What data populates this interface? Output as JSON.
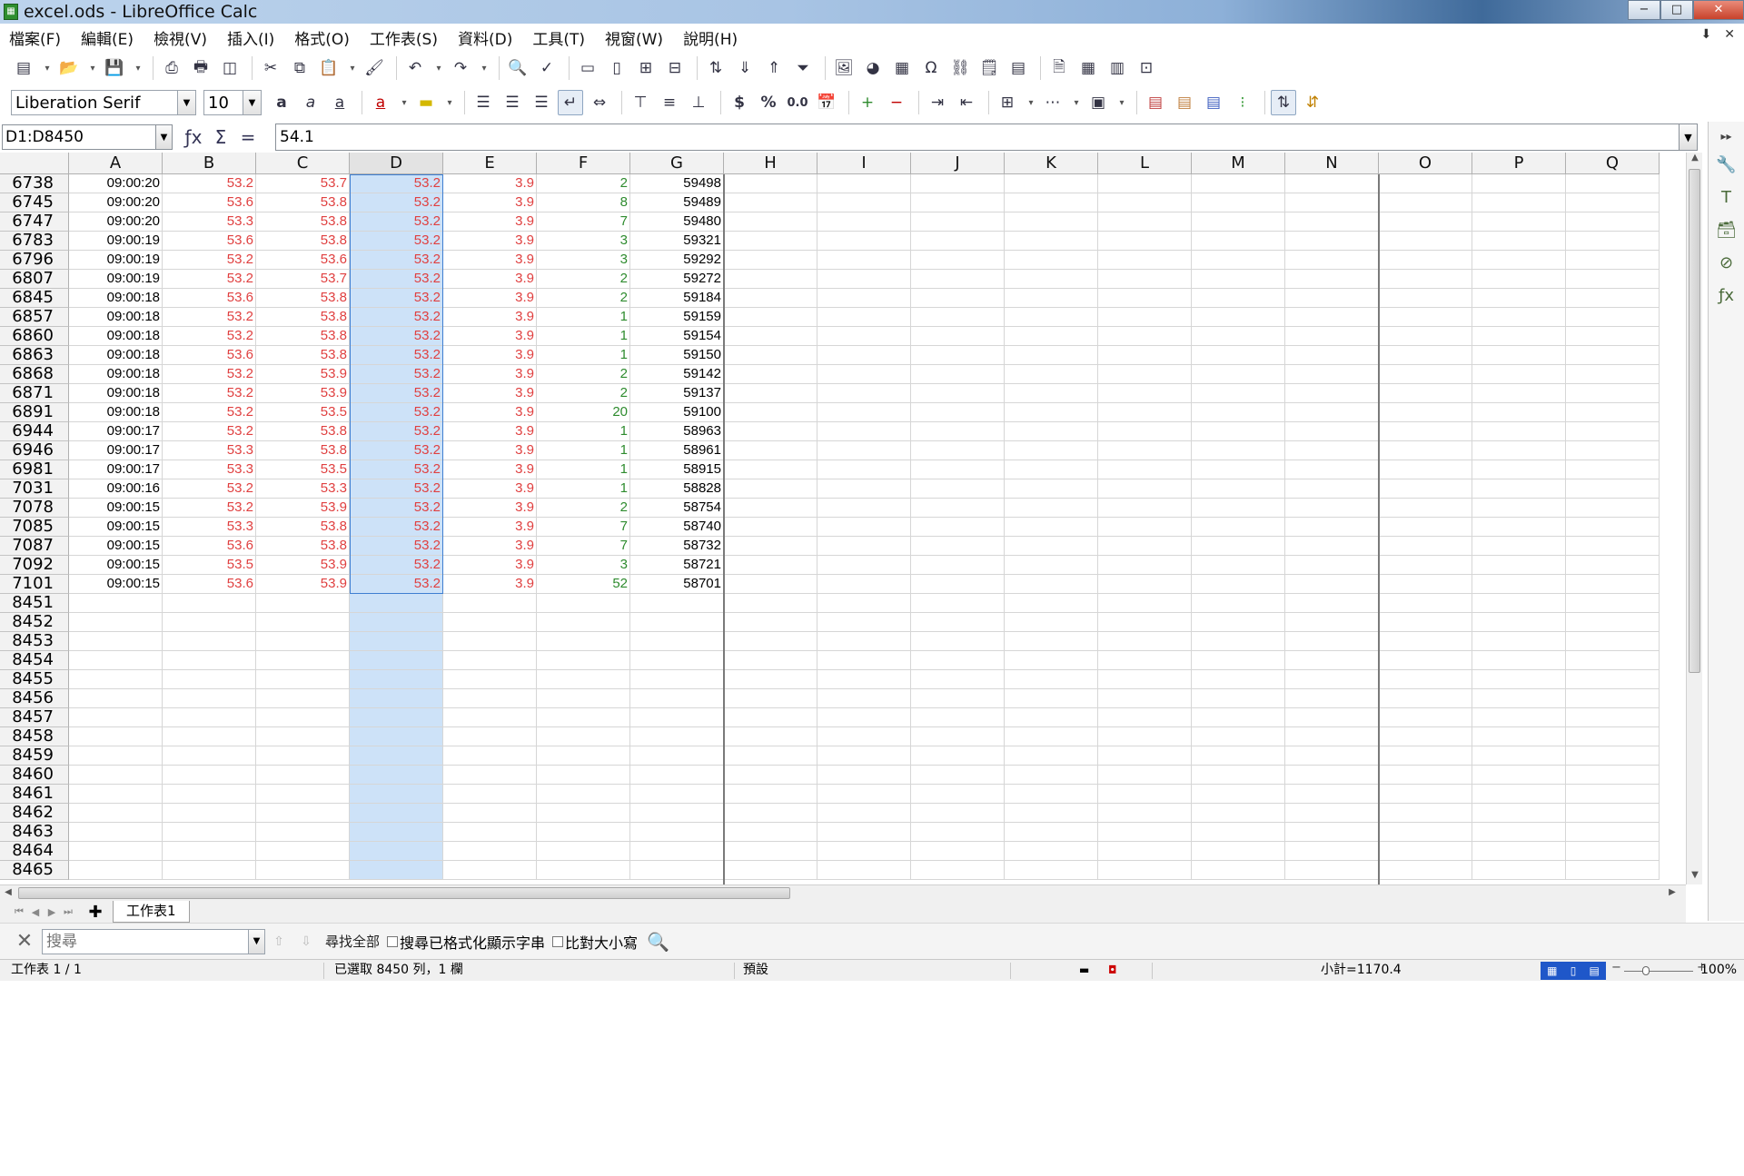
{
  "window": {
    "title": "excel.ods - LibreOffice Calc",
    "minimize": "−",
    "maximize": "□",
    "close": "✕"
  },
  "menu": [
    "檔案(F)",
    "編輯(E)",
    "檢視(V)",
    "插入(I)",
    "格式(O)",
    "工作表(S)",
    "資料(D)",
    "工具(T)",
    "視窗(W)",
    "說明(H)"
  ],
  "font": {
    "name": "Liberation Serif",
    "size": "10"
  },
  "formula": {
    "name_box": "D1:D8450",
    "content": "54.1"
  },
  "columns": [
    "A",
    "B",
    "C",
    "D",
    "E",
    "F",
    "G",
    "H",
    "I",
    "J",
    "K",
    "L",
    "M",
    "N",
    "O",
    "P",
    "Q"
  ],
  "rows": [
    {
      "n": "6738",
      "a": "09:00:20",
      "b": "53.2",
      "c": "53.7",
      "d": "53.2",
      "e": "3.9",
      "f": "2",
      "g": "59498"
    },
    {
      "n": "6745",
      "a": "09:00:20",
      "b": "53.6",
      "c": "53.8",
      "d": "53.2",
      "e": "3.9",
      "f": "8",
      "g": "59489"
    },
    {
      "n": "6747",
      "a": "09:00:20",
      "b": "53.3",
      "c": "53.8",
      "d": "53.2",
      "e": "3.9",
      "f": "7",
      "g": "59480"
    },
    {
      "n": "6783",
      "a": "09:00:19",
      "b": "53.6",
      "c": "53.8",
      "d": "53.2",
      "e": "3.9",
      "f": "3",
      "g": "59321"
    },
    {
      "n": "6796",
      "a": "09:00:19",
      "b": "53.2",
      "c": "53.6",
      "d": "53.2",
      "e": "3.9",
      "f": "3",
      "g": "59292"
    },
    {
      "n": "6807",
      "a": "09:00:19",
      "b": "53.2",
      "c": "53.7",
      "d": "53.2",
      "e": "3.9",
      "f": "2",
      "g": "59272"
    },
    {
      "n": "6845",
      "a": "09:00:18",
      "b": "53.6",
      "c": "53.8",
      "d": "53.2",
      "e": "3.9",
      "f": "2",
      "g": "59184"
    },
    {
      "n": "6857",
      "a": "09:00:18",
      "b": "53.2",
      "c": "53.8",
      "d": "53.2",
      "e": "3.9",
      "f": "1",
      "g": "59159"
    },
    {
      "n": "6860",
      "a": "09:00:18",
      "b": "53.2",
      "c": "53.8",
      "d": "53.2",
      "e": "3.9",
      "f": "1",
      "g": "59154"
    },
    {
      "n": "6863",
      "a": "09:00:18",
      "b": "53.6",
      "c": "53.8",
      "d": "53.2",
      "e": "3.9",
      "f": "1",
      "g": "59150"
    },
    {
      "n": "6868",
      "a": "09:00:18",
      "b": "53.2",
      "c": "53.9",
      "d": "53.2",
      "e": "3.9",
      "f": "2",
      "g": "59142"
    },
    {
      "n": "6871",
      "a": "09:00:18",
      "b": "53.2",
      "c": "53.9",
      "d": "53.2",
      "e": "3.9",
      "f": "2",
      "g": "59137"
    },
    {
      "n": "6891",
      "a": "09:00:18",
      "b": "53.2",
      "c": "53.5",
      "d": "53.2",
      "e": "3.9",
      "f": "20",
      "g": "59100"
    },
    {
      "n": "6944",
      "a": "09:00:17",
      "b": "53.2",
      "c": "53.8",
      "d": "53.2",
      "e": "3.9",
      "f": "1",
      "g": "58963"
    },
    {
      "n": "6946",
      "a": "09:00:17",
      "b": "53.3",
      "c": "53.8",
      "d": "53.2",
      "e": "3.9",
      "f": "1",
      "g": "58961"
    },
    {
      "n": "6981",
      "a": "09:00:17",
      "b": "53.3",
      "c": "53.5",
      "d": "53.2",
      "e": "3.9",
      "f": "1",
      "g": "58915"
    },
    {
      "n": "7031",
      "a": "09:00:16",
      "b": "53.2",
      "c": "53.3",
      "d": "53.2",
      "e": "3.9",
      "f": "1",
      "g": "58828"
    },
    {
      "n": "7078",
      "a": "09:00:15",
      "b": "53.2",
      "c": "53.9",
      "d": "53.2",
      "e": "3.9",
      "f": "2",
      "g": "58754"
    },
    {
      "n": "7085",
      "a": "09:00:15",
      "b": "53.3",
      "c": "53.8",
      "d": "53.2",
      "e": "3.9",
      "f": "7",
      "g": "58740"
    },
    {
      "n": "7087",
      "a": "09:00:15",
      "b": "53.6",
      "c": "53.8",
      "d": "53.2",
      "e": "3.9",
      "f": "7",
      "g": "58732"
    },
    {
      "n": "7092",
      "a": "09:00:15",
      "b": "53.5",
      "c": "53.9",
      "d": "53.2",
      "e": "3.9",
      "f": "3",
      "g": "58721"
    },
    {
      "n": "7101",
      "a": "09:00:15",
      "b": "53.6",
      "c": "53.9",
      "d": "53.2",
      "e": "3.9",
      "f": "52",
      "g": "58701"
    },
    {
      "n": "8451"
    },
    {
      "n": "8452"
    },
    {
      "n": "8453"
    },
    {
      "n": "8454"
    },
    {
      "n": "8455"
    },
    {
      "n": "8456"
    },
    {
      "n": "8457"
    },
    {
      "n": "8458"
    },
    {
      "n": "8459"
    },
    {
      "n": "8460"
    },
    {
      "n": "8461"
    },
    {
      "n": "8462"
    },
    {
      "n": "8463"
    },
    {
      "n": "8464"
    },
    {
      "n": "8465"
    }
  ],
  "sheet_tabs": [
    "工作表1"
  ],
  "find": {
    "placeholder": "搜尋",
    "find_all": "尋找全部",
    "formatted": "搜尋已格式化顯示字串",
    "match_case": "比對大小寫"
  },
  "status": {
    "sheet": "工作表 1 / 1",
    "selection": "已選取 8450 列，1 欄",
    "style": "預設",
    "sum": "小計=1170.4",
    "zoom": "100%"
  },
  "colors": {
    "value_red": "#e04040",
    "value_green": "#2e8b2e",
    "selection_fill": "#cde2f8",
    "selection_border": "#3f7fd1"
  }
}
